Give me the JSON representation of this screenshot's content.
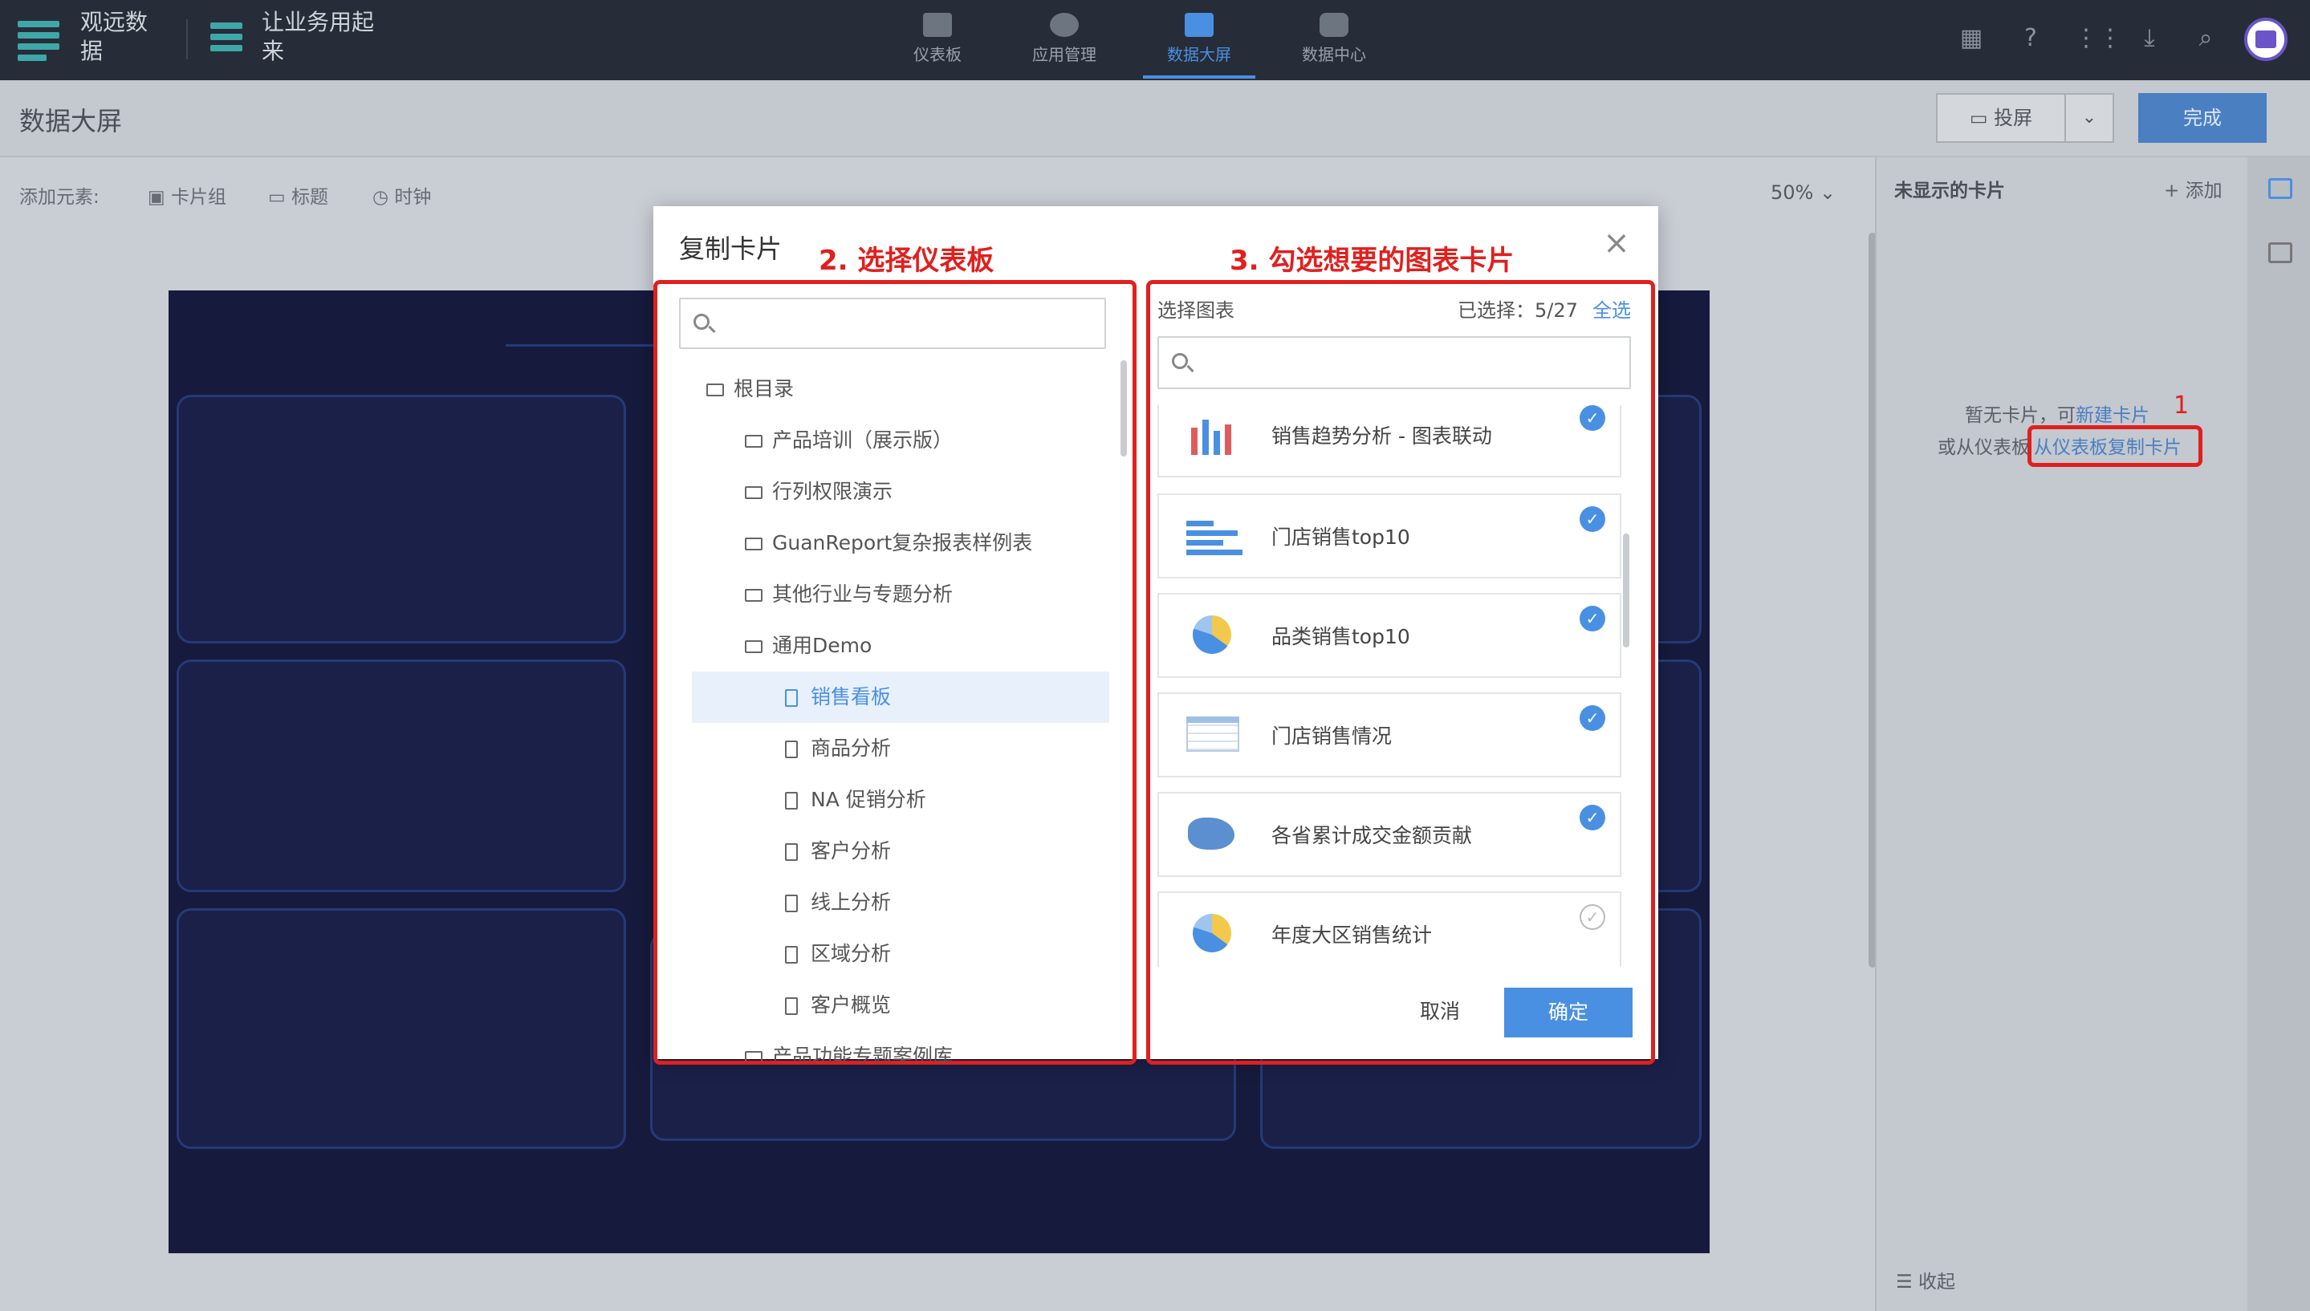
{
  "brand": {
    "name": "观远数据",
    "slogan": "让业务用起来"
  },
  "nav": [
    {
      "label": "仪表板",
      "icon": "bar-chart-icon"
    },
    {
      "label": "应用管理",
      "icon": "apps-icon"
    },
    {
      "label": "数据大屏",
      "icon": "big-screen-icon",
      "active": true
    },
    {
      "label": "数据中心",
      "icon": "database-icon"
    }
  ],
  "header": {
    "title": "数据大屏",
    "cast_label": "投屏",
    "done_label": "完成"
  },
  "toolbar": {
    "add_label": "添加元素:",
    "items": [
      "卡片组",
      "标题",
      "时钟"
    ],
    "zoom": "50%"
  },
  "right_panel": {
    "title": "未显示的卡片",
    "add_label": "添加",
    "empty_line1_prefix": "暂无卡片，可",
    "empty_line1_link": "新建卡片",
    "empty_line2_prefix": "或从仪表板",
    "empty_line2_link": "从仪表板复制卡片",
    "annotation": "1",
    "collapse_label": "收起"
  },
  "modal": {
    "title": "复制卡片",
    "step2": "2. 选择仪表板",
    "step3": "3. 勾选想要的图表卡片",
    "tree": [
      {
        "label": "根目录",
        "level": 0,
        "type": "folder-open"
      },
      {
        "label": "产品培训（展示版）",
        "level": 1,
        "type": "folder"
      },
      {
        "label": "行列权限演示",
        "level": 1,
        "type": "folder"
      },
      {
        "label": "GuanReport复杂报表样例表",
        "level": 1,
        "type": "folder"
      },
      {
        "label": "其他行业与专题分析",
        "level": 1,
        "type": "folder"
      },
      {
        "label": "通用Demo",
        "level": 1,
        "type": "folder-open"
      },
      {
        "label": "销售看板",
        "level": 2,
        "type": "doc",
        "selected": true
      },
      {
        "label": "商品分析",
        "level": 2,
        "type": "doc"
      },
      {
        "label": "NA 促销分析",
        "level": 2,
        "type": "doc"
      },
      {
        "label": "客户分析",
        "level": 2,
        "type": "doc"
      },
      {
        "label": "线上分析",
        "level": 2,
        "type": "doc"
      },
      {
        "label": "区域分析",
        "level": 2,
        "type": "doc"
      },
      {
        "label": "客户概览",
        "level": 2,
        "type": "doc"
      },
      {
        "label": "产品功能专题案例库",
        "level": 1,
        "type": "folder"
      }
    ],
    "select_title": "选择图表",
    "selected_count": "已选择：5/27",
    "select_all": "全选",
    "cards": [
      {
        "label": "销售趋势分析 - 图表联动",
        "icon": "line-bar-chart-icon",
        "checked": true
      },
      {
        "label": "门店销售top10",
        "icon": "horizontal-bar-chart-icon",
        "checked": true
      },
      {
        "label": "品类销售top10",
        "icon": "pie-chart-icon",
        "checked": true
      },
      {
        "label": "门店销售情况",
        "icon": "table-icon",
        "checked": true
      },
      {
        "label": "各省累计成交金额贡献",
        "icon": "map-icon",
        "checked": true
      },
      {
        "label": "年度大区销售统计",
        "icon": "pie-chart-icon",
        "checked": false
      }
    ],
    "cancel_label": "取消",
    "ok_label": "确定"
  },
  "colors": {
    "accent": "#4a90e2",
    "annotation_red": "#e0201e",
    "topbar": "#262d38"
  }
}
